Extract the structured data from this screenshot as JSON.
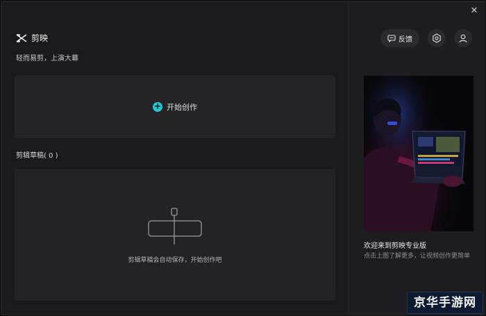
{
  "header": {
    "app_name": "剪映",
    "tagline": "轻而易剪，上演大幕"
  },
  "start": {
    "label": "开始创作"
  },
  "drafts": {
    "heading": "剪辑草稿( 0 )",
    "empty_hint": "剪辑草稿会自动保存，开始创作吧"
  },
  "toolbar": {
    "feedback_label": "反馈",
    "settings_icon": "settings-icon",
    "account_icon": "user-icon",
    "close_icon": "close-icon",
    "close_glyph": "✕"
  },
  "promo": {
    "title": "欢迎来到剪映专业版",
    "description": "点击上图了解更多，让视频创作更简单"
  },
  "watermark": {
    "text": "京华手游网"
  },
  "colors": {
    "accent": "#22c8d4",
    "background": "#1a1a1c",
    "card": "#242426"
  }
}
